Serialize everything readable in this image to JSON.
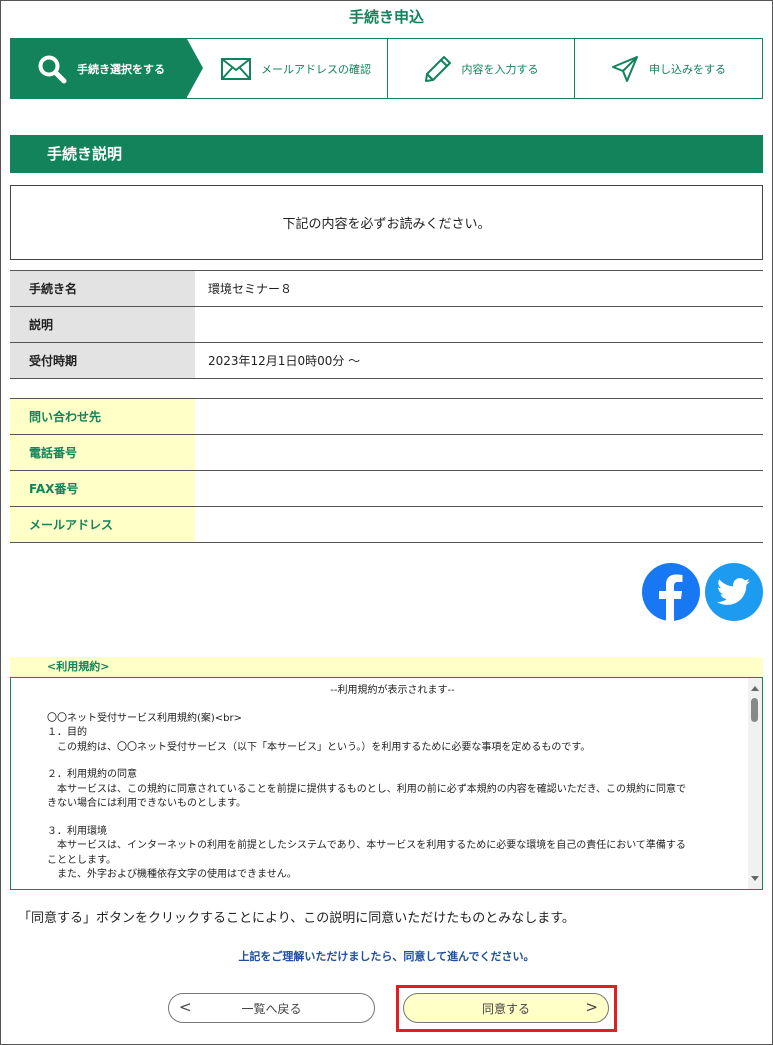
{
  "page_title": "手続き申込",
  "steps": [
    {
      "label": "手続き選択をする",
      "icon": "search-icon",
      "active": true
    },
    {
      "label": "メールアドレスの確認",
      "icon": "envelope-icon",
      "active": false
    },
    {
      "label": "内容を入力する",
      "icon": "pencil-icon",
      "active": false
    },
    {
      "label": "申し込みをする",
      "icon": "paper-plane-icon",
      "active": false
    }
  ],
  "section_title": "手続き説明",
  "notice": "下記の内容を必ずお読みください。",
  "procedure_info": [
    {
      "label": "手続き名",
      "value": "環境セミナー８"
    },
    {
      "label": "説明",
      "value": ""
    },
    {
      "label": "受付時期",
      "value": "2023年12月1日0時00分 ～"
    }
  ],
  "contact_info": [
    {
      "label": "問い合わせ先",
      "value": ""
    },
    {
      "label": "電話番号",
      "value": ""
    },
    {
      "label": "FAX番号",
      "value": ""
    },
    {
      "label": "メールアドレス",
      "value": ""
    }
  ],
  "social": {
    "facebook_icon": "facebook-icon",
    "twitter_icon": "twitter-icon"
  },
  "terms": {
    "label": "<利用規約>",
    "lines": {
      "header": "--利用規約が表示されます--",
      "title": "〇〇ネット受付サービス利用規約(案)<br>",
      "s1_title": "１．目的",
      "s1_body": "この規約は、〇〇ネット受付サービス（以下「本サービス」という。）を利用するために必要な事項を定めるものです。",
      "s2_title": "２．利用規約の同意",
      "s2_body_1": "本サービスは、この規約に同意されていることを前提に提供するものとし、利用の前に必ず本規約の内容を確認いただき、この規約に同意で",
      "s2_body_2": "きない場合には利用できないものとします。",
      "s3_title": "３．利用環境",
      "s3_body_1": "本サービスは、インターネットの利用を前提としたシステムであり、本サービスを利用するために必要な環境を自己の責任において準備する",
      "s3_body_2": "こととします。",
      "s3_body_3": "また、外字および機種依存文字の使用はできません。"
    }
  },
  "consent_text": "「同意する」ボタンをクリックすることにより、この説明に同意いただけたものとみなします。",
  "proceed_text": "上記をご理解いただけましたら、同意して進んでください。",
  "buttons": {
    "back_label": "一覧へ戻る",
    "back_arrow": "<",
    "agree_label": "同意する",
    "agree_arrow": ">"
  },
  "colors": {
    "brand_green": "#12835a",
    "highlight_yellow": "#ffffc8",
    "link_blue": "#1e4f9c",
    "emphasis_red": "#e02020"
  }
}
